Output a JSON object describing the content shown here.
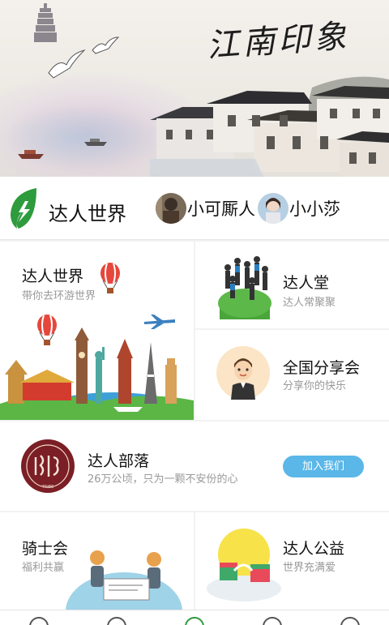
{
  "banner": {
    "calligraphy": "江南印象"
  },
  "talent": {
    "title": "达人世界",
    "users": [
      {
        "name": "小可厮人"
      },
      {
        "name": "小小莎"
      }
    ]
  },
  "cards": {
    "world": {
      "title": "达人世界",
      "subtitle": "带你去环游世界"
    },
    "hall": {
      "title": "达人堂",
      "subtitle": "达人常聚聚"
    },
    "share": {
      "title": "全国分享会",
      "subtitle": "分享你的快乐"
    },
    "tribe": {
      "title": "达人部落",
      "subtitle": "26万公顷，只为一颗不安份的心",
      "button": "加入我们"
    },
    "knight": {
      "title": "骑士会",
      "subtitle": "福利共赢"
    },
    "charity": {
      "title": "达人公益",
      "subtitle": "世界充满爱"
    }
  },
  "colors": {
    "accent_green": "#2e9b3c",
    "button_blue": "#5ab7e8",
    "subtext": "#999999"
  },
  "icons": [
    "leaf-icon",
    "hot-air-balloon-icon",
    "globe-icon",
    "crowd-icon",
    "man-avatar-icon",
    "tribe-seal-icon",
    "bike-icon",
    "gift-icon"
  ]
}
